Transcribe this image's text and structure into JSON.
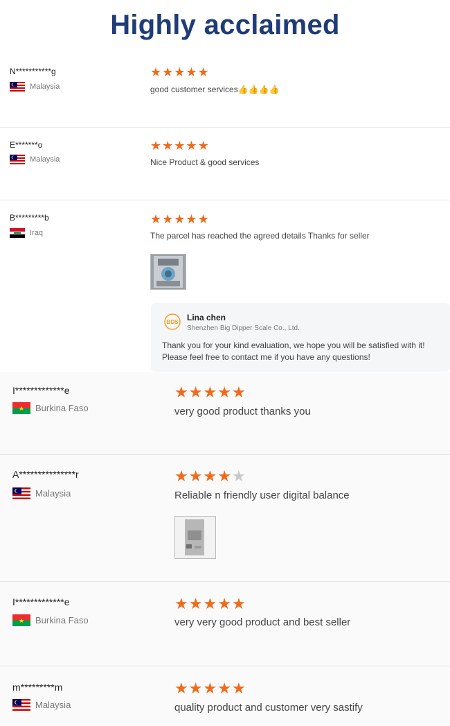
{
  "heading": "Highly acclaimed",
  "reviews": [
    {
      "name": "N***********g",
      "country": "Malaysia",
      "flag": "malaysia",
      "rating": 5,
      "text": "good customer services👍👍👍👍"
    },
    {
      "name": "E*******o",
      "country": "Malaysia",
      "flag": "malaysia",
      "rating": 5,
      "text": "Nice Product & good services"
    },
    {
      "name": "B*********b",
      "country": "Iraq",
      "flag": "iraq",
      "rating": 5,
      "text": "The parcel has reached the agreed details Thanks for seller"
    },
    {
      "name": "I*************e",
      "country": "Burkina Faso",
      "flag": "burkina-faso",
      "rating": 5,
      "text": "very good product thanks you"
    },
    {
      "name": "A***************r",
      "country": "Malaysia",
      "flag": "malaysia",
      "rating": 4,
      "text": "Reliable n friendly user digital balance"
    },
    {
      "name": "I*************e",
      "country": "Burkina Faso",
      "flag": "burkina-faso",
      "rating": 5,
      "text": "very very good product and best seller"
    },
    {
      "name": "m*********m",
      "country": "Malaysia",
      "flag": "malaysia",
      "rating": 5,
      "text": "quality product and customer very sastify"
    }
  ],
  "seller_reply": {
    "name": "Lina chen",
    "company": "Shenzhen Big Dipper Scale Co., Ltd.",
    "logo_text": "BDS",
    "message_line1": "Thank you for your kind evaluation, we hope you will be satisfied with it!",
    "message_line2": "Please feel free to contact me if you have any questions!"
  },
  "colors": {
    "title": "#1f3c78",
    "star": "#f06a1a",
    "star_empty": "#c8c8c8"
  },
  "star_glyph": "★"
}
